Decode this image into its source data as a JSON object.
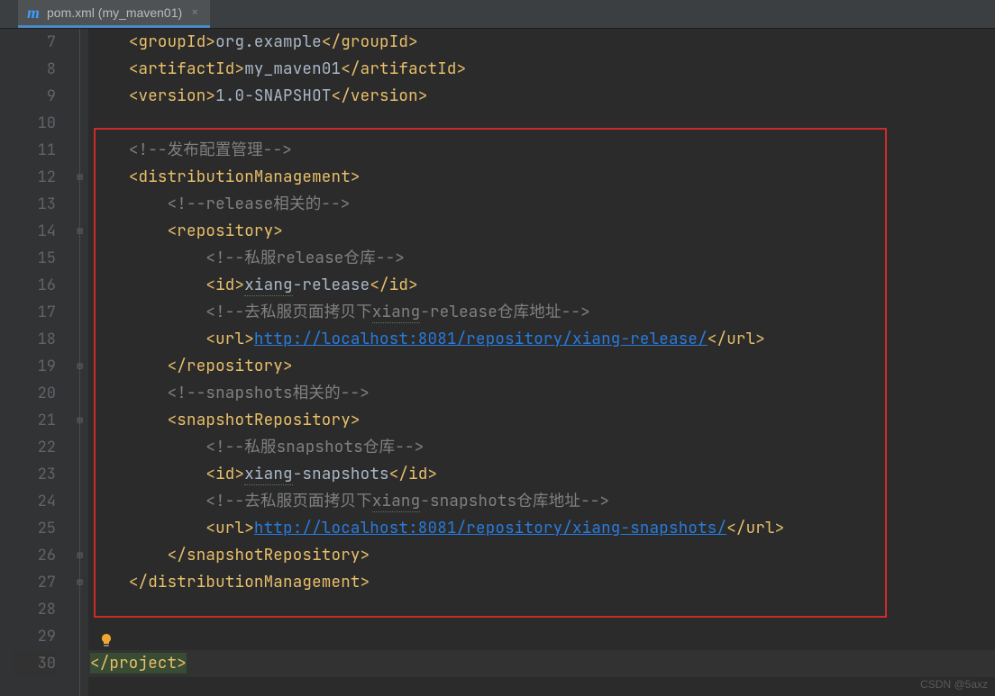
{
  "tab": {
    "icon": "m",
    "label": "pom.xml (my_maven01)"
  },
  "gutter_start": 7,
  "lines": [
    {
      "n": 7,
      "indent": 2,
      "kind": "tag-text-tag",
      "open": "groupId",
      "text": "org.example",
      "close": "groupId"
    },
    {
      "n": 8,
      "indent": 2,
      "kind": "tag-text-tag",
      "open": "artifactId",
      "text": "my_maven01",
      "close": "artifactId"
    },
    {
      "n": 9,
      "indent": 2,
      "kind": "tag-text-tag",
      "open": "version",
      "text": "1.0-SNAPSHOT",
      "close": "version"
    },
    {
      "n": 10,
      "indent": 0,
      "kind": "blank"
    },
    {
      "n": 11,
      "indent": 2,
      "kind": "comment",
      "text": "<!--发布配置管理-->"
    },
    {
      "n": 12,
      "indent": 2,
      "kind": "open-tag",
      "tag": "distributionManagement",
      "fold": "open"
    },
    {
      "n": 13,
      "indent": 4,
      "kind": "comment",
      "text": "<!--release相关的-->"
    },
    {
      "n": 14,
      "indent": 4,
      "kind": "open-tag",
      "tag": "repository",
      "fold": "open"
    },
    {
      "n": 15,
      "indent": 6,
      "kind": "comment",
      "text": "<!--私服release仓库-->"
    },
    {
      "n": 16,
      "indent": 6,
      "kind": "tag-squig-tag",
      "open": "id",
      "pre": "xiang",
      "post": "-release",
      "close": "id"
    },
    {
      "n": 17,
      "indent": 6,
      "kind": "comment-squig",
      "pre": "<!--去私服页面拷贝下",
      "squig": "xiang",
      "post": "-release仓库地址-->"
    },
    {
      "n": 18,
      "indent": 6,
      "kind": "tag-url-tag",
      "open": "url",
      "url": "http://localhost:8081/repository/xiang-release/",
      "close": "url"
    },
    {
      "n": 19,
      "indent": 4,
      "kind": "close-tag",
      "tag": "repository",
      "fold": "close"
    },
    {
      "n": 20,
      "indent": 4,
      "kind": "comment",
      "text": "<!--snapshots相关的-->"
    },
    {
      "n": 21,
      "indent": 4,
      "kind": "open-tag",
      "tag": "snapshotRepository",
      "fold": "open"
    },
    {
      "n": 22,
      "indent": 6,
      "kind": "comment",
      "text": "<!--私服snapshots仓库-->"
    },
    {
      "n": 23,
      "indent": 6,
      "kind": "tag-squig-tag",
      "open": "id",
      "pre": "xiang",
      "post": "-snapshots",
      "close": "id"
    },
    {
      "n": 24,
      "indent": 6,
      "kind": "comment-squig",
      "pre": "<!--去私服页面拷贝下",
      "squig": "xiang",
      "post": "-snapshots仓库地址-->"
    },
    {
      "n": 25,
      "indent": 6,
      "kind": "tag-url-tag",
      "open": "url",
      "url": "http://localhost:8081/repository/xiang-snapshots/",
      "close": "url"
    },
    {
      "n": 26,
      "indent": 4,
      "kind": "close-tag",
      "tag": "snapshotRepository",
      "fold": "close"
    },
    {
      "n": 27,
      "indent": 2,
      "kind": "close-tag",
      "tag": "distributionManagement",
      "fold": "close"
    },
    {
      "n": 28,
      "indent": 0,
      "kind": "blank"
    },
    {
      "n": 29,
      "indent": 0,
      "kind": "bulb"
    },
    {
      "n": 30,
      "indent": 0,
      "kind": "close-project",
      "tag": "project",
      "active": true
    }
  ],
  "highlight": {
    "top_line": 11,
    "bottom_line": 28
  },
  "watermark": "CSDN @5axz"
}
